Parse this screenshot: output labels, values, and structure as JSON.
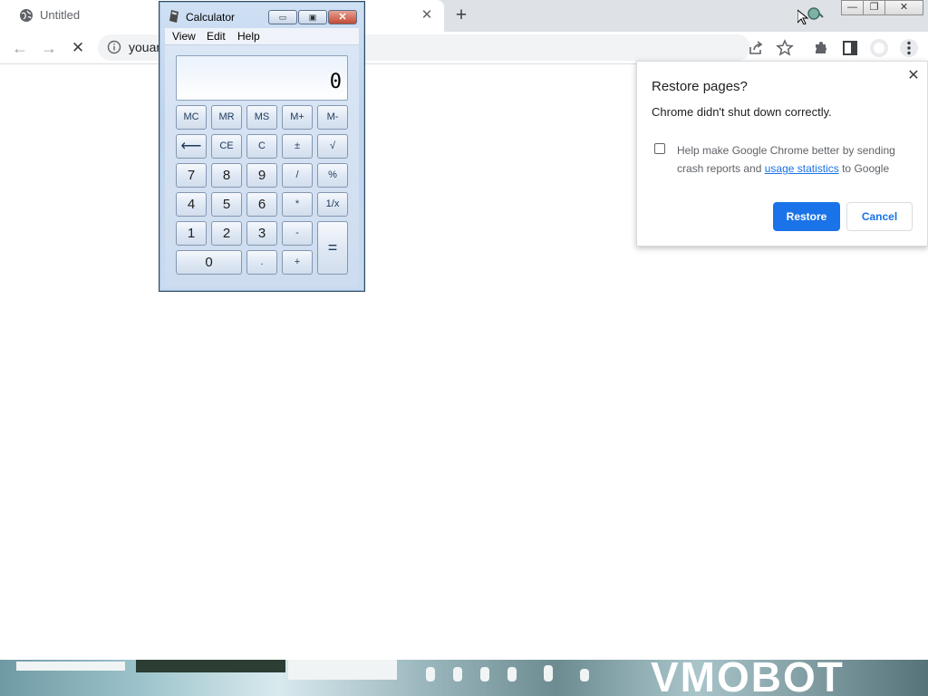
{
  "browser": {
    "tab": {
      "title": "Untitled",
      "close_glyph": "✕"
    },
    "new_tab_glyph": "+",
    "window_controls": {
      "minimize": "—",
      "restore": "❐",
      "close": "✕"
    },
    "toolbar": {
      "back_glyph": "←",
      "forward_glyph": "→",
      "stop_glyph": "✕",
      "address_text": "youar"
    }
  },
  "calculator": {
    "title": "Calculator",
    "menu": [
      "View",
      "Edit",
      "Help"
    ],
    "display": "0",
    "keys": {
      "row1": [
        "MC",
        "MR",
        "MS",
        "M+",
        "M-"
      ],
      "row2": [
        "⟵",
        "CE",
        "C",
        "±",
        "√"
      ],
      "row3": [
        "7",
        "8",
        "9",
        "/",
        "%"
      ],
      "row4": [
        "4",
        "5",
        "6",
        "*",
        "1/x"
      ],
      "row5": [
        "1",
        "2",
        "3",
        "-",
        "="
      ],
      "row6": [
        "0",
        ".",
        "+"
      ]
    },
    "titlebar_buttons": {
      "minimize": "▭",
      "maximize": "▣",
      "close": "✕"
    }
  },
  "restore_dialog": {
    "title": "Restore pages?",
    "message": "Chrome didn't shut down correctly.",
    "checkbox_text_before": "Help make Google Chrome better by sending crash reports and ",
    "checkbox_link": "usage statistics",
    "checkbox_text_after": " to Google",
    "checkbox_checked": false,
    "restore_label": "Restore",
    "cancel_label": "Cancel",
    "close_glyph": "✕"
  },
  "background_banner_text": "VMOBOT",
  "colors": {
    "chrome_blue": "#1a73e8",
    "tabstrip": "#dee1e6",
    "calc_frame": "#bfd3ec"
  }
}
